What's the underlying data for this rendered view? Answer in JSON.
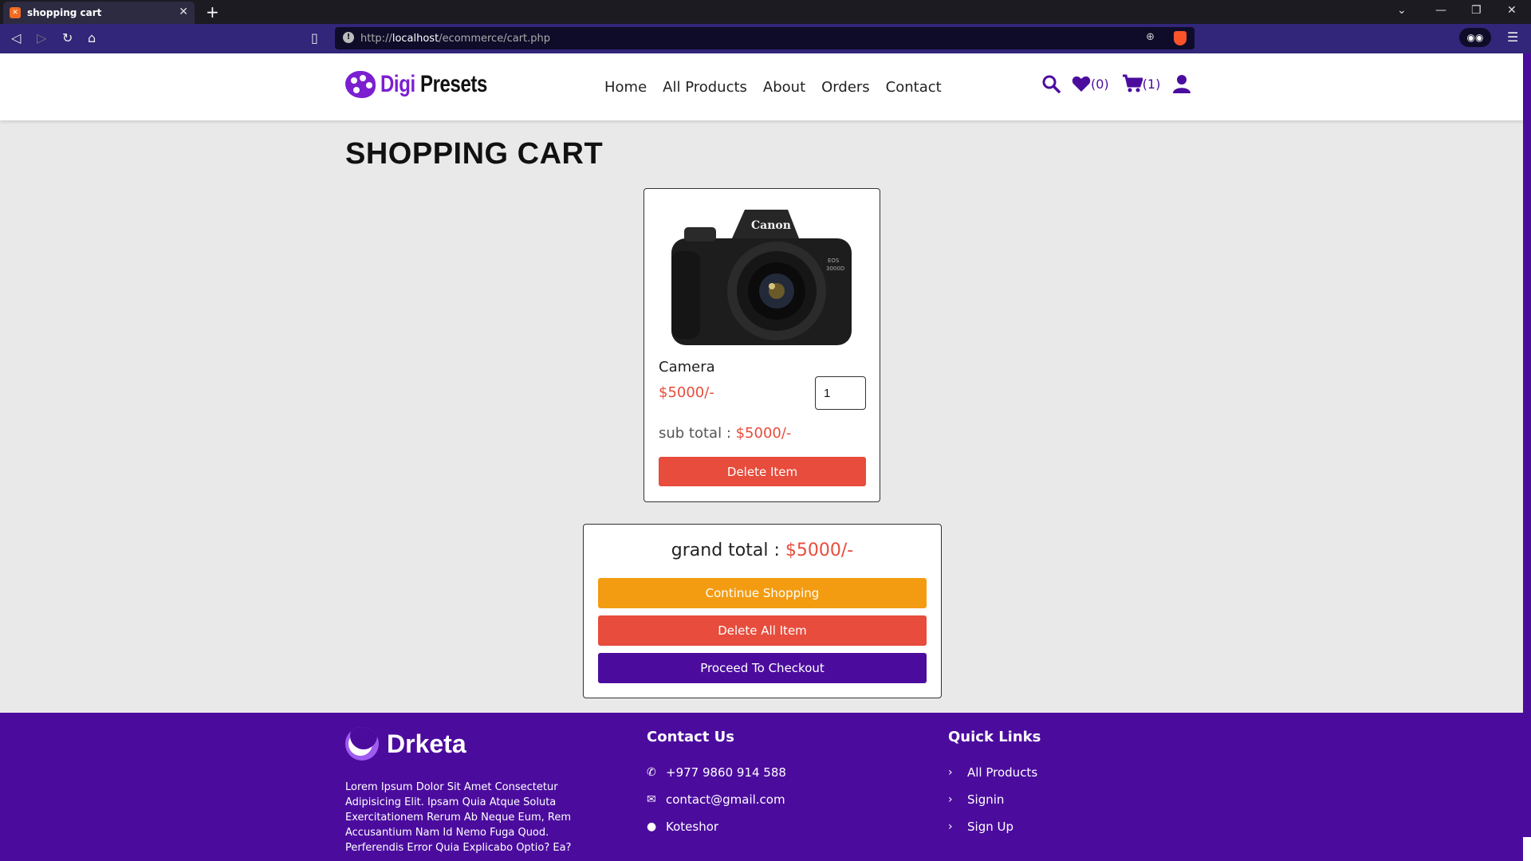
{
  "browser": {
    "tab_title": "shopping cart",
    "url_prefix": "http://",
    "url_host": "localhost",
    "url_path": "/ecommerce/cart.php"
  },
  "header": {
    "logo_part1": "Digi",
    "logo_part2": "Presets",
    "nav": [
      "Home",
      "All Products",
      "About",
      "Orders",
      "Contact"
    ],
    "wishlist_count": "(0)",
    "cart_count": "(1)"
  },
  "page": {
    "title": "SHOPPING CART"
  },
  "cart_item": {
    "name": "Camera",
    "price": "$5000/-",
    "quantity": "1",
    "subtotal_label": "sub total : ",
    "subtotal_value": "$5000/-",
    "delete_label": "Delete Item"
  },
  "summary": {
    "grand_total_label": "grand total : ",
    "grand_total_value": "$5000/-",
    "continue_label": "Continue Shopping",
    "delete_all_label": "Delete All Item",
    "checkout_label": "Proceed To Checkout"
  },
  "footer": {
    "brand": "Drketa",
    "description": "Lorem Ipsum Dolor Sit Amet Consectetur Adipisicing Elit. Ipsam Quia Atque Soluta Exercitationem Rerum Ab Neque Eum, Rem Accusantium Nam Id Nemo Fuga Quod. Perferendis Error Quia Explicabo Optio? Ea?",
    "contact_heading": "Contact Us",
    "phone": "+977 9860 914 588",
    "email": "contact@gmail.com",
    "location": "Koteshor",
    "links_heading": "Quick Links",
    "links": [
      "All Products",
      "Signin",
      "Sign Up"
    ]
  },
  "colors": {
    "brand_purple": "#4b0c9e",
    "price_red": "#e74c3c",
    "continue_orange": "#f39c12"
  }
}
